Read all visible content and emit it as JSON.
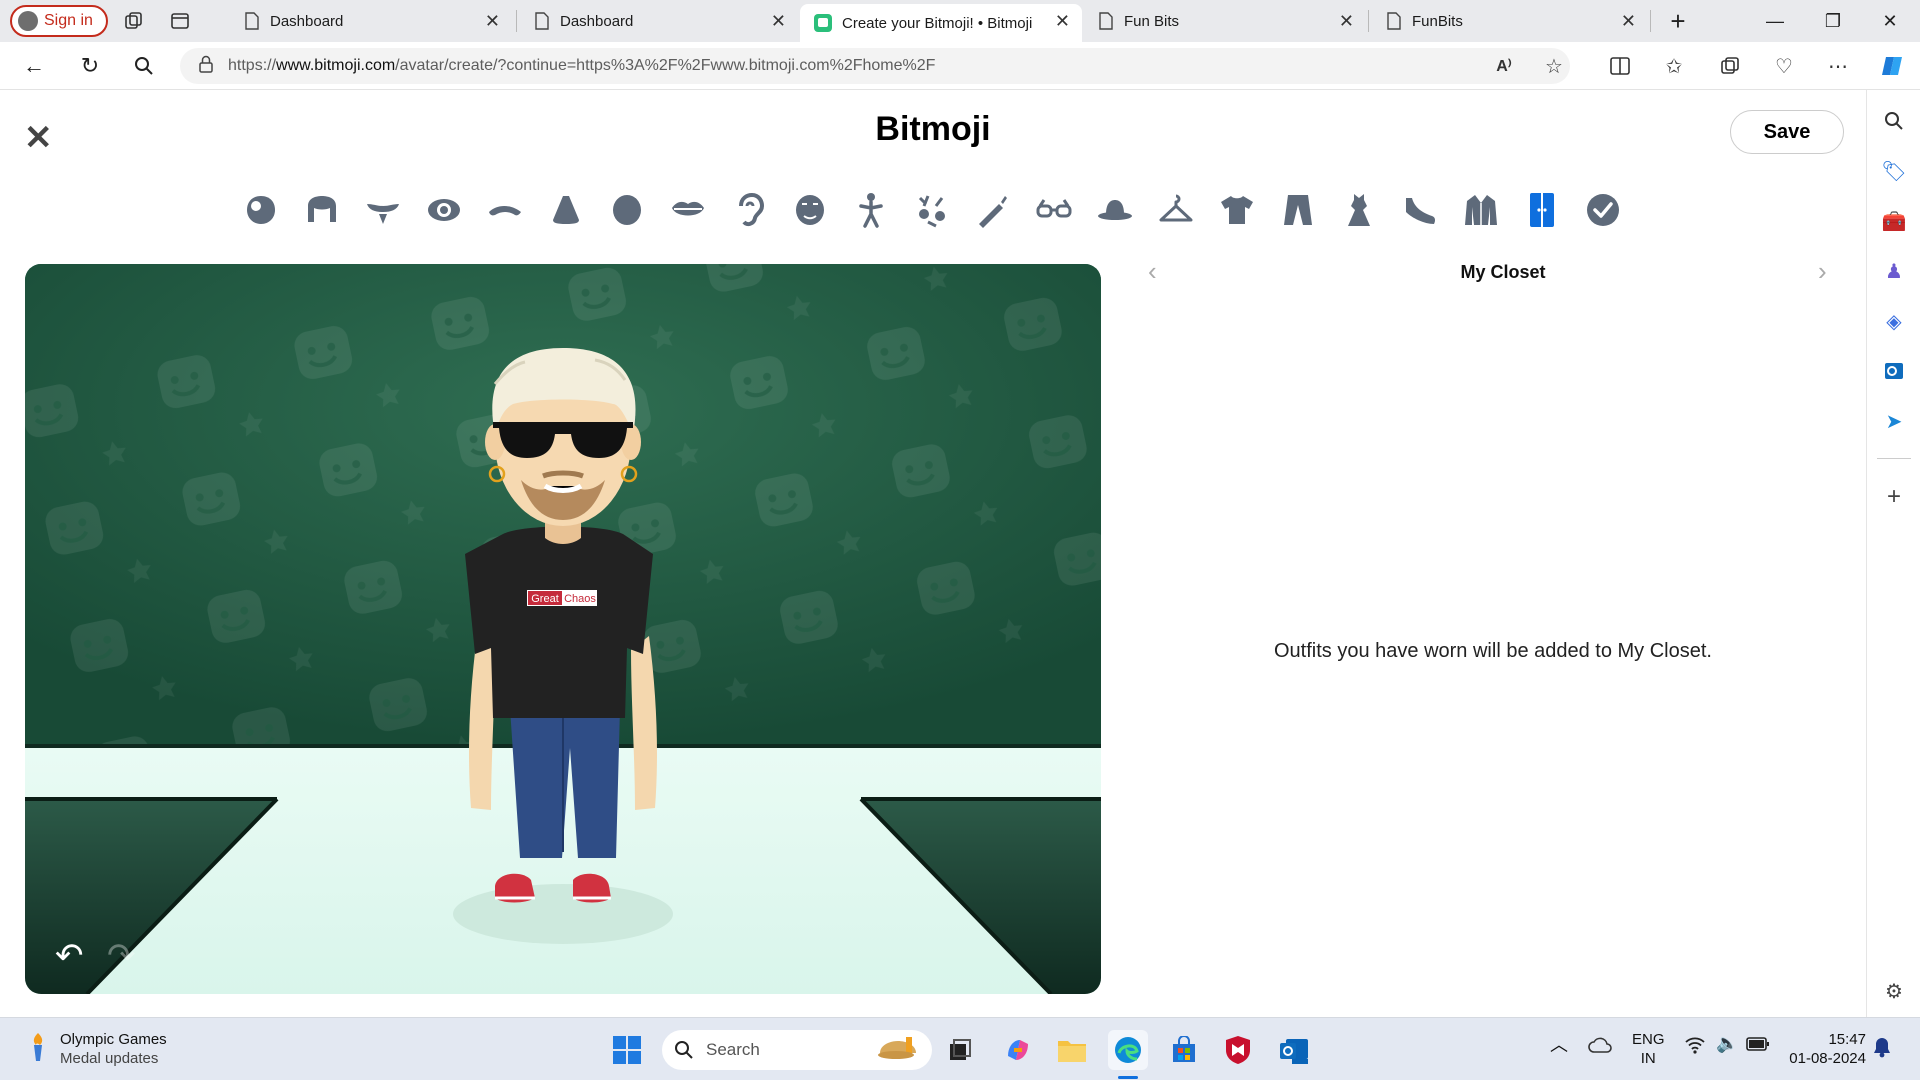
{
  "browser": {
    "signin_label": "Sign in",
    "tabs": [
      {
        "title": "Dashboard"
      },
      {
        "title": "Dashboard"
      },
      {
        "title": "Create your Bitmoji! • Bitmoji"
      },
      {
        "title": "Fun Bits"
      },
      {
        "title": "FunBits"
      }
    ],
    "url_prefix": "https://",
    "url_domain": "www.bitmoji.com",
    "url_rest": "/avatar/create/?continue=https%3A%2F%2Fwww.bitmoji.com%2Fhome%2F"
  },
  "page": {
    "brand": "Bitmoji",
    "save_label": "Save",
    "closet_title": "My Closet",
    "empty_message": "Outfits you have worn will be added to My Closet.",
    "shirt_text_1": "Great",
    "shirt_text_2": "Chaos",
    "categories": [
      {
        "icon": "face-shape-icon"
      },
      {
        "icon": "hair-icon"
      },
      {
        "icon": "facial-hair-icon"
      },
      {
        "icon": "eye-icon"
      },
      {
        "icon": "eyebrow-icon"
      },
      {
        "icon": "nose-icon"
      },
      {
        "icon": "head-icon"
      },
      {
        "icon": "lips-icon"
      },
      {
        "icon": "ear-icon"
      },
      {
        "icon": "face-lines-icon"
      },
      {
        "icon": "body-icon"
      },
      {
        "icon": "accessories-icon"
      },
      {
        "icon": "makeup-icon"
      },
      {
        "icon": "glasses-icon"
      },
      {
        "icon": "hat-icon"
      },
      {
        "icon": "hanger-icon"
      },
      {
        "icon": "tshirt-icon"
      },
      {
        "icon": "pants-icon"
      },
      {
        "icon": "dress-icon"
      },
      {
        "icon": "shoe-icon"
      },
      {
        "icon": "outerwear-icon"
      },
      {
        "icon": "closet-icon"
      },
      {
        "icon": "checkmark-icon"
      }
    ],
    "active_category": "closet-icon",
    "accent": "#0f6fde"
  },
  "taskbar": {
    "widget_title": "Olympic Games",
    "widget_sub": "Medal updates",
    "search_placeholder": "Search",
    "lang_top": "ENG",
    "lang_bottom": "IN",
    "time": "15:47",
    "date": "01-08-2024"
  }
}
